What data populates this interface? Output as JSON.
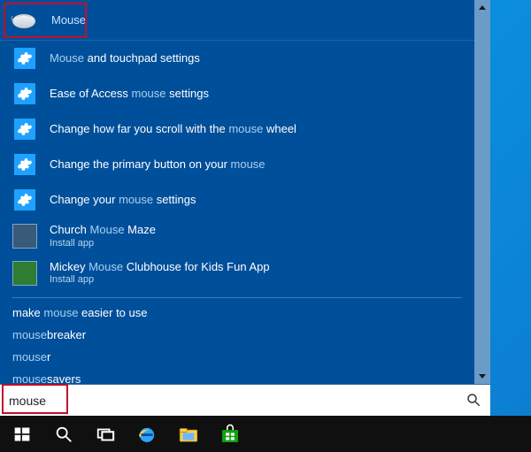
{
  "best_match": {
    "label": "Mouse"
  },
  "settings_results": [
    {
      "pre": "",
      "kw": "Mouse",
      "post": " and touchpad settings"
    },
    {
      "pre": "Ease of Access ",
      "kw": "mouse",
      "post": " settings"
    },
    {
      "pre": "Change how far you scroll with the ",
      "kw": "mouse",
      "post": " wheel"
    },
    {
      "pre": "Change the primary button on your ",
      "kw": "mouse",
      "post": ""
    },
    {
      "pre": "Change your ",
      "kw": "mouse",
      "post": " settings"
    }
  ],
  "app_results": [
    {
      "pre": "Church ",
      "kw": "Mouse",
      "post": " Maze",
      "sub": "Install app",
      "style": "gray"
    },
    {
      "pre": "Mickey ",
      "kw": "Mouse",
      "post": " Clubhouse for Kids Fun App",
      "sub": "Install app",
      "style": "green"
    }
  ],
  "suggestions": [
    {
      "pre": "make ",
      "kw": "mouse",
      "post": " easier to use"
    },
    {
      "pre": "",
      "kw": "mouse",
      "post": "breaker"
    },
    {
      "pre": "",
      "kw": "mouse",
      "post": "r"
    },
    {
      "pre": "",
      "kw": "mouse",
      "post": "savers"
    }
  ],
  "search": {
    "value": "mouse"
  },
  "taskbar": {
    "items": [
      "start",
      "search",
      "taskview",
      "ie",
      "explorer",
      "store"
    ]
  },
  "colors": {
    "panel": "#004f9b",
    "accent": "#1fa2ff"
  }
}
